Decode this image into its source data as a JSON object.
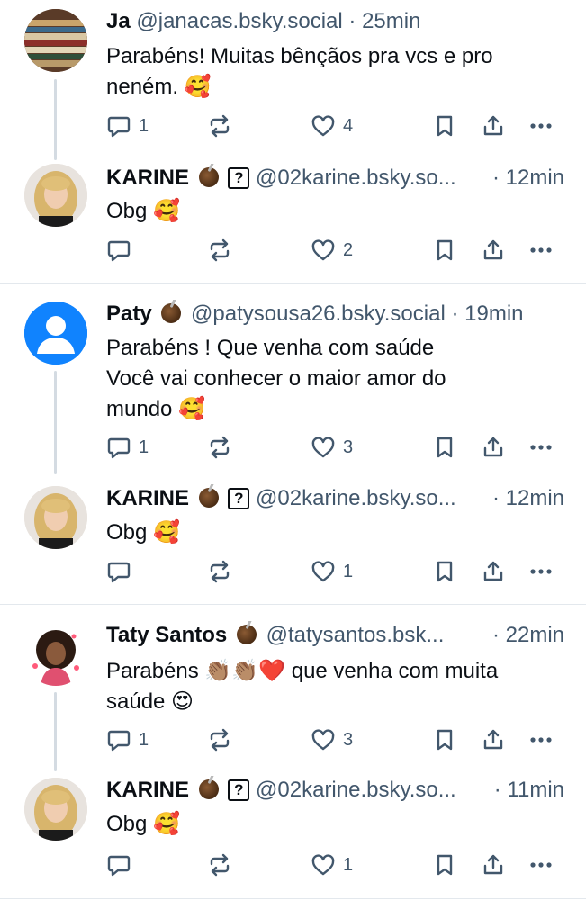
{
  "posts": [
    {
      "name": "Ja",
      "handle": "@janacas.bsky.social",
      "sep": "·",
      "time": "25min",
      "text": "Parabéns! Muitas bênçãos pra vcs e pro\nneném. 🥰",
      "reply_count": "1",
      "like_count": "4",
      "avatar": "books-avatar"
    },
    {
      "name": "KARINE",
      "handle": "@02karine.bsky.so...",
      "sep": "·",
      "time": "12min",
      "text": "Obg 🥰",
      "reply_count": "",
      "like_count": "2",
      "avatar": "karine-avatar"
    },
    {
      "name": "Paty",
      "handle": "@patysousa26.bsky.social",
      "sep": "·",
      "time": "19min",
      "text": "Parabéns ! Que venha com saúde\nVocê vai conhecer o maior amor do\nmundo 🥰",
      "reply_count": "1",
      "like_count": "3",
      "avatar": "default-avatar"
    },
    {
      "name": "KARINE",
      "handle": "@02karine.bsky.so...",
      "sep": "·",
      "time": "12min",
      "text": "Obg 🥰",
      "reply_count": "",
      "like_count": "1",
      "avatar": "karine-avatar"
    },
    {
      "name": "Taty Santos",
      "handle": "@tatysantos.bsk...",
      "sep": "·",
      "time": "22min",
      "text": "Parabéns 👏🏽👏🏽❤️ que venha com muita\nsaúde 😍",
      "reply_count": "1",
      "like_count": "3",
      "avatar": "girl-avatar"
    },
    {
      "name": "KARINE",
      "handle": "@02karine.bsky.so...",
      "sep": "·",
      "time": "11min",
      "text": "Obg 🥰",
      "reply_count": "",
      "like_count": "1",
      "avatar": "karine-avatar"
    }
  ],
  "colors": {
    "text": "#0b0f14",
    "muted": "#42576c",
    "thread_line": "#d4dbe2",
    "divider": "#e3e8ed",
    "default_avatar": "#1083fe"
  },
  "icons": [
    "reply-icon",
    "repost-icon",
    "like-icon",
    "bookmark-icon",
    "share-icon",
    "more-icon",
    "mate-gourd-icon",
    "unknown-glyph-icon"
  ]
}
